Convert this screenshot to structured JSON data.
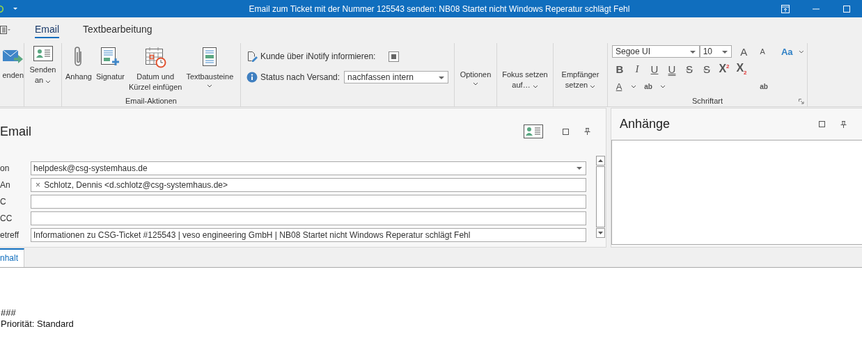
{
  "window": {
    "title": "Email zum Ticket mit der Nummer 125543 senden: NB08 Startet nicht Windows Reperatur schlägt Fehl"
  },
  "ribbon_tabs": [
    {
      "label": "Email",
      "selected": true
    },
    {
      "label": "Textbearbeitung",
      "selected": false
    }
  ],
  "ribbon": {
    "send": {
      "lines": [
        "enden"
      ]
    },
    "send_to": {
      "lines": [
        "Senden",
        "an"
      ],
      "dropdown": true
    },
    "actions": {
      "label": "Email-Aktionen",
      "buttons": [
        {
          "lines": [
            "Anhang"
          ],
          "dropdown": false
        },
        {
          "lines": [
            "Signatur"
          ],
          "dropdown": false
        },
        {
          "lines": [
            "Datum und",
            "Kürzel einfügen"
          ],
          "dropdown": false
        },
        {
          "lines": [
            "Textbausteine"
          ],
          "dropdown": true
        }
      ]
    },
    "notify": {
      "label": "Kunde über iNotify informieren:",
      "checked": true
    },
    "status": {
      "label": "Status nach Versand:",
      "value": "nachfassen intern"
    },
    "menus": [
      {
        "lines": [
          "Optionen"
        ]
      },
      {
        "lines": [
          "Fokus setzen",
          "auf…"
        ]
      },
      {
        "lines": [
          "Empfänger",
          "setzen"
        ]
      }
    ],
    "font": {
      "label": "Schriftart",
      "family": "Segoe UI",
      "size": "10",
      "format_buttons": [
        {
          "label": "B",
          "kind": "bold"
        },
        {
          "label": "I",
          "kind": "italic"
        },
        {
          "label": "U",
          "kind": "underline"
        },
        {
          "label": "U",
          "kind": "double-underline"
        },
        {
          "label": "S",
          "kind": "strike"
        },
        {
          "label": "S",
          "kind": "strike"
        },
        {
          "label": "X$^{2}$",
          "kind": "script"
        },
        {
          "label": "X$_{2}$",
          "kind": "script"
        }
      ],
      "grow": "A",
      "shrink": "A",
      "case": "Aa",
      "font_color_button": "A",
      "highlight": "ab",
      "clear": "ab"
    }
  },
  "email_panel": {
    "title": "Email",
    "fields": [
      {
        "label": "on",
        "kind": "dropdown",
        "value": "helpdesk@csg-systemhaus.de"
      },
      {
        "label": "An",
        "kind": "recipients",
        "tokens": [
          {
            "remove": "×",
            "text": "Schlotz, Dennis <d.schlotz@csg-systemhaus.de>"
          }
        ]
      },
      {
        "label": "C",
        "kind": "text"
      },
      {
        "label": "CC",
        "kind": "text"
      },
      {
        "label": "etreff",
        "kind": "text",
        "value": "Informationen zu CSG-Ticket #125543 | veso engineering GmbH | NB08 Startet nicht Windows Reperatur schlägt Fehl"
      }
    ]
  },
  "attachments_panel": {
    "title": "Anhänge"
  },
  "content_tabs": [
    {
      "label": "nhalt",
      "selected": true
    }
  ],
  "body": {
    "lines": [
      "###",
      "Priorität: Standard"
    ]
  }
}
